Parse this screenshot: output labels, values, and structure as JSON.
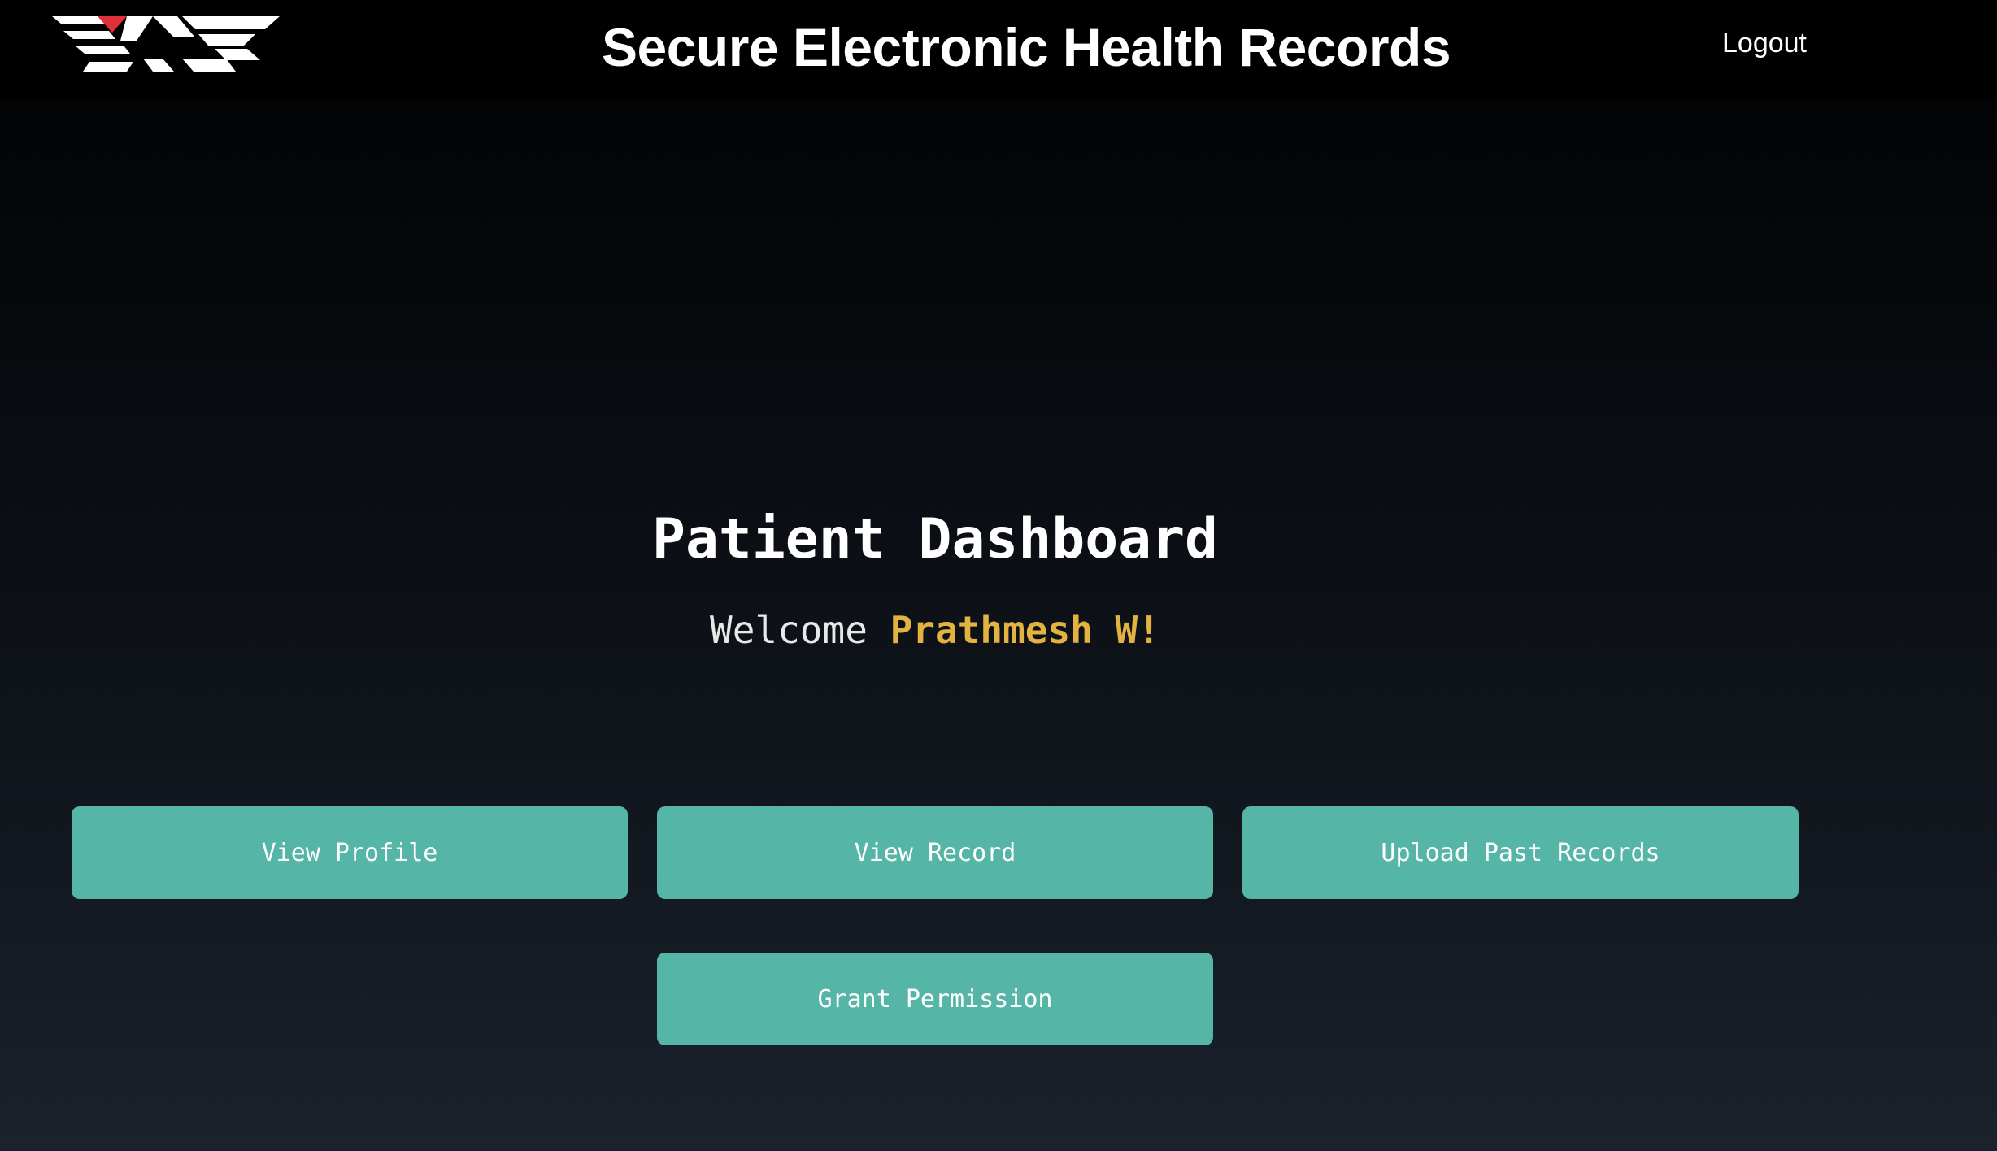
{
  "header": {
    "logo_icon": "ehr-logo-icon",
    "title": "Secure Electronic Health Records",
    "logout_label": "Logout"
  },
  "main": {
    "page_title": "Patient Dashboard",
    "welcome_prefix": "Welcome",
    "welcome_name": "Prathmesh W!"
  },
  "actions": {
    "view_profile": "View Profile",
    "view_record": "View Record",
    "upload_past_records": "Upload Past Records",
    "grant_permission": "Grant Permission"
  },
  "colors": {
    "accent_button": "#55b5a6",
    "name_highlight": "#e3b341",
    "logo_red": "#e0303a",
    "header_bg": "#000000"
  }
}
